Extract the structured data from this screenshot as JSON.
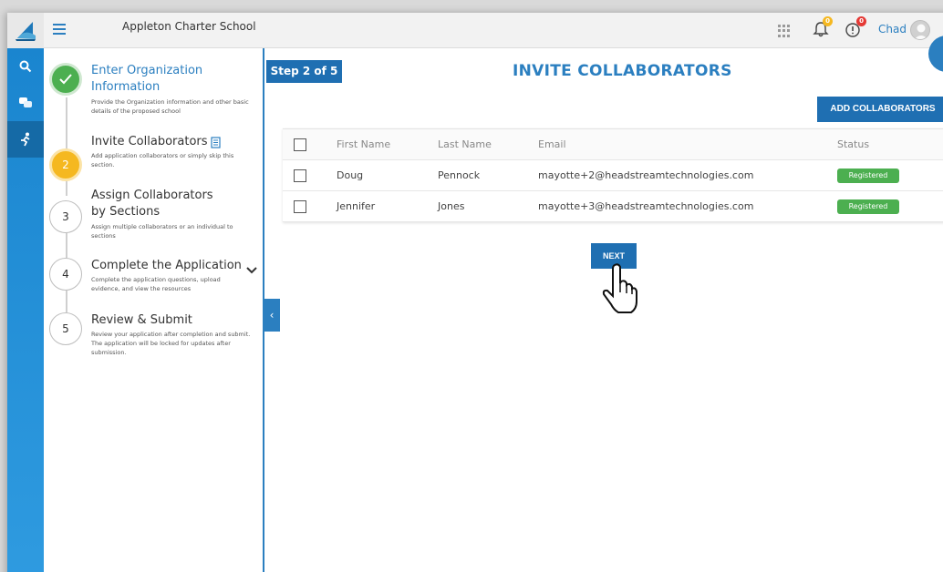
{
  "header": {
    "school_name": "Appleton Charter School",
    "user_name": "Chad",
    "notifications_badge": "0",
    "alerts_badge": "0"
  },
  "rail": {
    "items": [
      {
        "icon": "search-icon"
      },
      {
        "icon": "chat-icon"
      },
      {
        "icon": "runner-icon"
      }
    ]
  },
  "steps": [
    {
      "number": "1",
      "title": "Enter Organization Information",
      "description": "Provide the Organization information and other basic details of the proposed school",
      "state": "complete"
    },
    {
      "number": "2",
      "title": "Invite Collaborators",
      "description": "Add application collaborators or simply skip this section.",
      "state": "current"
    },
    {
      "number": "3",
      "title": "Assign Collaborators by Sections",
      "description": "Assign multiple collaborators or an individual to sections",
      "state": "pending"
    },
    {
      "number": "4",
      "title": "Complete the Application",
      "description": "Complete the application questions, upload evidence, and view the resources",
      "state": "pending"
    },
    {
      "number": "5",
      "title": "Review & Submit",
      "description": "Review your application after completion and submit. The application will be locked for updates after submission.",
      "state": "pending"
    }
  ],
  "main": {
    "step_label": "Step 2 of 5",
    "title": "INVITE COLLABORATORS",
    "add_button": "ADD COLLABORATORS",
    "next_button": "NEXT",
    "table": {
      "columns": [
        "First Name",
        "Last Name",
        "Email",
        "Status"
      ],
      "rows": [
        {
          "first": "Doug",
          "last": "Pennock",
          "email": "mayotte+2@headstreamtechnologies.com",
          "status": "Registered"
        },
        {
          "first": "Jennifer",
          "last": "Jones",
          "email": "mayotte+3@headstreamtechnologies.com",
          "status": "Registered"
        }
      ]
    }
  },
  "colors": {
    "primary": "#1f6fb2",
    "accent": "#2b7fc0",
    "success": "#4caf50",
    "current_step": "#f5b820",
    "badge_bell": "#f5b820",
    "badge_alert": "#e53935"
  }
}
